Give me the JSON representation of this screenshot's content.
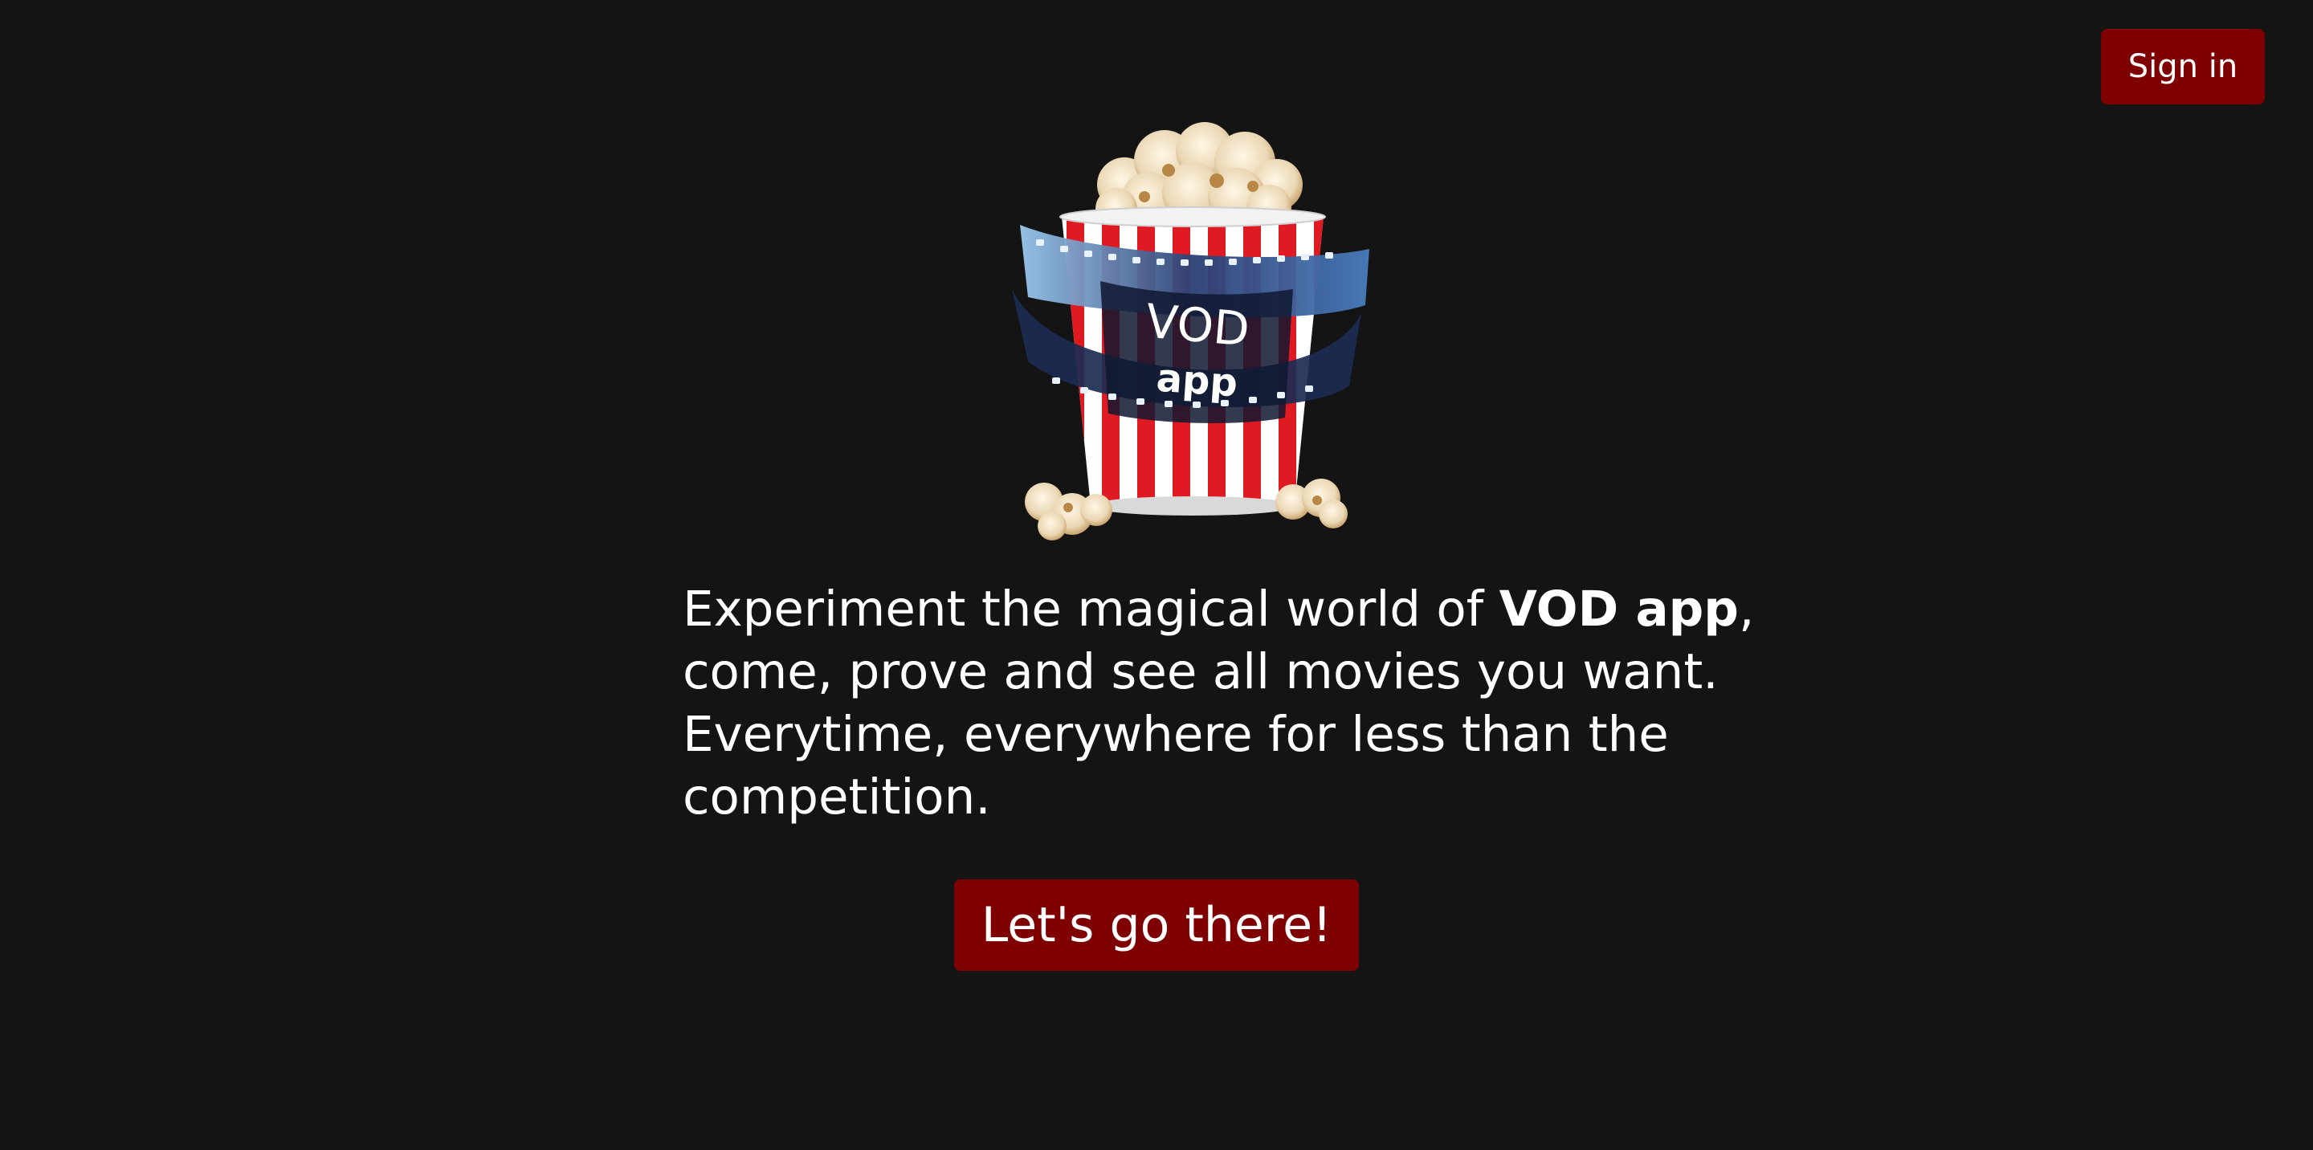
{
  "header": {
    "signin_label": "Sign in"
  },
  "logo": {
    "text_top": "VOD",
    "text_bottom": "app"
  },
  "hero": {
    "line1_before": "Experiment the magical world of ",
    "line1_bold": "VOD app",
    "line1_after": ",",
    "line2": "come, prove and see all movies you want.",
    "line3": "Everytime, everywhere for less than the",
    "line4": "competition.",
    "cta_label": "Let's go there!"
  },
  "colors": {
    "background": "#141414",
    "accent": "#7f0000",
    "text": "#ffffff"
  }
}
